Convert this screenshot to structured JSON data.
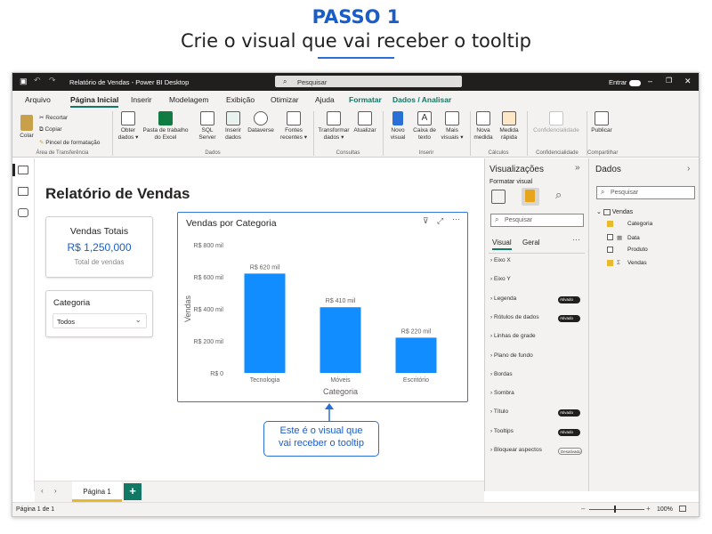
{
  "header": {
    "step": "PASSO 1",
    "subtitle": "Crie o visual que vai receber o tooltip"
  },
  "titlebar": {
    "title": "Relatório de Vendas - Power BI Desktop",
    "search_placeholder": "Pesquisar",
    "signin": "Entrar"
  },
  "menu": {
    "tabs": [
      "Arquivo",
      "Página Inicial",
      "Inserir",
      "Modelagem",
      "Exibição",
      "Otimizar",
      "Ajuda",
      "Formatar",
      "Dados / Analisar"
    ]
  },
  "ribbon": {
    "clipboard": {
      "paste": "Colar",
      "cut": "Recortar",
      "copy": "Copiar",
      "format_painter": "Pincel de formatação",
      "group": "Área de Transferência"
    },
    "data": {
      "get_data": "Obter dados",
      "excel": "Pasta de trabalho do Excel",
      "sql": "SQL Server",
      "enter_data": "Inserir dados",
      "dataverse": "Dataverse",
      "recent": "Fontes recentes",
      "group": "Dados"
    },
    "queries": {
      "transform": "Transformar dados",
      "refresh": "Atualizar",
      "group": "Consultas"
    },
    "insert": {
      "new_visual": "Novo visual",
      "text_box": "Caixa de texto",
      "more_visuals": "Mais visuais",
      "group": "Inserir"
    },
    "calc": {
      "new_measure": "Nova medida",
      "quick_measure": "Medida rápida",
      "group": "Cálculos"
    },
    "sens": {
      "label": "Confidencialidade",
      "group": "Confidencialidade"
    },
    "share": {
      "publish": "Publicar",
      "group": "Compartilhar"
    }
  },
  "report": {
    "title": "Relatório de Vendas",
    "kpi": {
      "label": "Vendas Totais",
      "value": "R$ 1,250,000",
      "caption": "Total de vendas"
    },
    "slicer": {
      "title": "Categoria",
      "value": "Todos"
    },
    "callout": {
      "line1": "Este é o visual que",
      "line2": "vai receber o tooltip"
    }
  },
  "chart_data": {
    "type": "bar",
    "title": "Vendas por Categoria",
    "categories": [
      "Tecnologia",
      "Móveis",
      "Escritório"
    ],
    "values": [
      620000,
      410000,
      220000
    ],
    "data_labels": [
      "R$ 620 mil",
      "R$ 410 mil",
      "R$ 220 mil"
    ],
    "xlabel": "Categoria",
    "ylabel": "Vendas",
    "ylim": [
      0,
      800000
    ],
    "yticks": [
      "R$ 0",
      "R$ 200 mil",
      "R$ 400 mil",
      "R$ 600 mil",
      "R$ 800 mil"
    ],
    "color": "#118dff",
    "grid": false
  },
  "viz_pane": {
    "title": "Visualizações",
    "subtitle": "Formatar visual",
    "search_placeholder": "Pesquisar",
    "tabs": [
      "Visual",
      "Geral"
    ],
    "sections": [
      {
        "label": "Eixo X",
        "toggle": ""
      },
      {
        "label": "Eixo Y",
        "toggle": ""
      },
      {
        "label": "Legenda",
        "toggle": "Ativado"
      },
      {
        "label": "Rótulos de dados",
        "toggle": "Ativado"
      },
      {
        "label": "Linhas de grade",
        "toggle": ""
      },
      {
        "label": "Plano de fundo",
        "toggle": ""
      },
      {
        "label": "Bordas",
        "toggle": ""
      },
      {
        "label": "Sombra",
        "toggle": ""
      },
      {
        "label": "Título",
        "toggle": "Ativado"
      },
      {
        "label": "Tooltips",
        "toggle": "Ativado"
      },
      {
        "label": "Bloquear aspectos",
        "toggle": "Desativado"
      }
    ]
  },
  "data_pane": {
    "title": "Dados",
    "search_placeholder": "Pesquisar",
    "table": "Vendas",
    "fields": [
      {
        "label": "Categoria",
        "checked": true
      },
      {
        "label": "Data",
        "checked": false
      },
      {
        "label": "Produto",
        "checked": false
      },
      {
        "label": "Vendas",
        "checked": true
      }
    ]
  },
  "pages": {
    "current": "Página 1",
    "status": "Página 1 de 1",
    "zoom": "100%"
  },
  "colors": {
    "accent": "#117865",
    "selection": "#3277d8",
    "bar": "#118dff",
    "brand_blue": "#1a5dc8"
  }
}
